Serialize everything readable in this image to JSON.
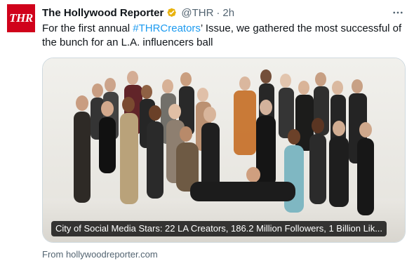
{
  "author": {
    "avatar_text": "THR",
    "name": "The Hollywood Reporter",
    "handle": "@THR",
    "separator": "·",
    "time": "2h",
    "verified_icon": "verified-badge-icon",
    "colors": {
      "avatar_bg": "#d0021b",
      "verified_badge": "#e8b20c"
    }
  },
  "tweet": {
    "text_before": "For the first annual ",
    "hashtag": "#THRCreators",
    "text_after": "’ Issue, we gathered the most successful of the bunch for an L.A. influencers ball"
  },
  "card": {
    "image_alt": "Group photo of creators posing in a white studio",
    "caption": "City of Social Media Stars: 22 LA Creators, 186.2 Million Followers, 1 Billion Lik...",
    "source": "From hollywoodreporter.com"
  },
  "menu_icon": "more-horizontal-icon",
  "colors": {
    "link": "#1d9bf0",
    "muted": "#536471",
    "border": "#cfd9de"
  }
}
